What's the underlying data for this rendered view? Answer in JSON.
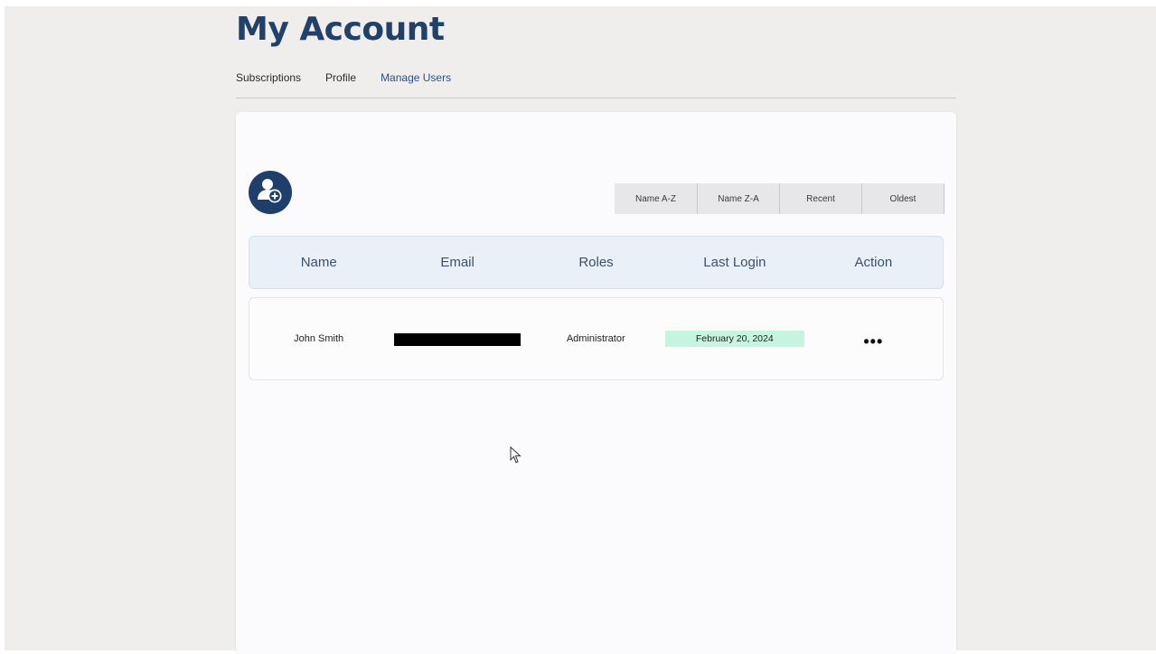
{
  "page": {
    "title": "My Account"
  },
  "tabs": [
    {
      "label": "Subscriptions",
      "active": false
    },
    {
      "label": "Profile",
      "active": false
    },
    {
      "label": "Manage Users",
      "active": true
    }
  ],
  "toolbar": {
    "add_user_icon": "add-user-icon",
    "sort_options": [
      "Name A-Z",
      "Name Z-A",
      "Recent",
      "Oldest"
    ]
  },
  "table": {
    "columns": [
      "Name",
      "Email",
      "Roles",
      "Last Login",
      "Action"
    ],
    "rows": [
      {
        "name": "John Smith",
        "email": "",
        "role": "Administrator",
        "last_login": "February 20, 2024",
        "action": "•••"
      }
    ]
  },
  "colors": {
    "title": "#21416b",
    "active_tab": "#2d4f82",
    "accent_button": "#1e3e6b",
    "header_bg": "#e9f0f8",
    "login_badge": "#c5f5de"
  }
}
